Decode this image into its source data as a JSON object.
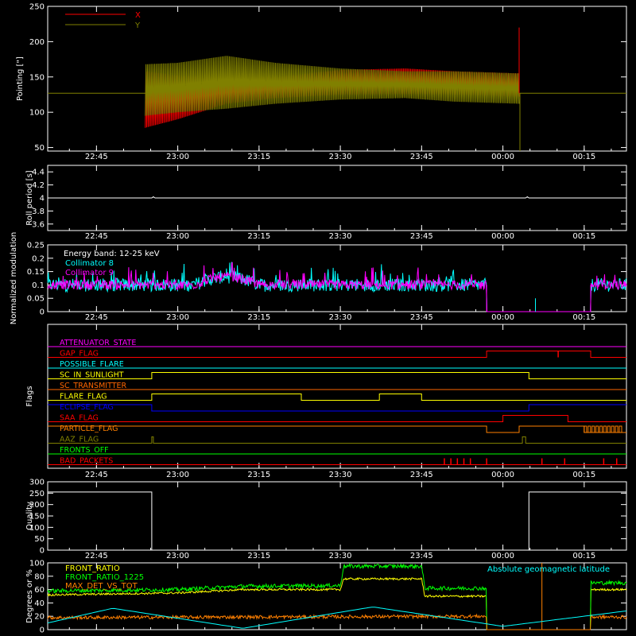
{
  "chart_data": [
    {
      "id": "pointing",
      "type": "line",
      "ylabel": "Pointing [\"]",
      "ylim": [
        45,
        250
      ],
      "yticks": [
        50,
        100,
        150,
        200,
        250
      ],
      "series": [
        {
          "name": "X",
          "color": "#ff0000"
        },
        {
          "name": "Y",
          "color": "#808000"
        }
      ],
      "baseline": 127,
      "active_range": [
        22.9,
        24.05
      ],
      "envelope_x": {
        "t": [
          22.9,
          23.0,
          23.15,
          23.3,
          23.5,
          23.7,
          23.85,
          24.05
        ],
        "lo": [
          78,
          90,
          112,
          120,
          125,
          126,
          125,
          122
        ],
        "hi": [
          158,
          152,
          148,
          150,
          160,
          162,
          158,
          155
        ]
      },
      "envelope_y": {
        "t": [
          22.9,
          23.0,
          23.15,
          23.3,
          23.5,
          23.7,
          23.85,
          24.05
        ],
        "lo": [
          95,
          100,
          105,
          112,
          118,
          120,
          115,
          112
        ],
        "hi": [
          168,
          170,
          180,
          170,
          162,
          158,
          158,
          155
        ]
      },
      "spike": {
        "t": 24.05,
        "value": 220
      }
    },
    {
      "id": "roll",
      "type": "line",
      "ylabel": "Roll period [s]",
      "ylim": [
        3.5,
        4.5
      ],
      "yticks": [
        3.6,
        3.8,
        4.0,
        4.2,
        4.4
      ],
      "series": [
        {
          "color": "#ffffff",
          "value": 4.0
        }
      ]
    },
    {
      "id": "modulation",
      "type": "line",
      "ylabel": "Normalized modulation",
      "ylim": [
        0,
        0.25
      ],
      "yticks": [
        0.0,
        0.05,
        0.1,
        0.15,
        0.2,
        0.25
      ],
      "annotation": "Energy band: 12-25 keV",
      "series": [
        {
          "name": "Collimator 8",
          "color": "#00ffff"
        },
        {
          "name": "Collimator 9",
          "color": "#ff00ff"
        }
      ],
      "gap": [
        23.95,
        24.27
      ],
      "spike": {
        "t": 24.1,
        "value": 0.05
      },
      "base_level": 0.1
    },
    {
      "id": "flags",
      "type": "line",
      "ylabel": "Flags",
      "flags": [
        {
          "name": "ATTENUATOR_STATE",
          "color": "#ff00ff",
          "segments": [
            [
              22.6,
              24.38,
              0
            ]
          ]
        },
        {
          "name": "GAP_FLAG",
          "color": "#ff0000",
          "segments": [
            [
              22.6,
              23.95,
              0
            ],
            [
              23.95,
              24.27,
              1
            ],
            [
              24.27,
              24.38,
              0
            ]
          ],
          "ticks": [
            24.17
          ]
        },
        {
          "name": "POSSIBLE_FLARE",
          "color": "#00ffff",
          "segments": [
            [
              22.6,
              24.38,
              0
            ]
          ]
        },
        {
          "name": "SC_IN_SUNLIGHT",
          "color": "#ffff00",
          "segments": [
            [
              22.6,
              22.92,
              0
            ],
            [
              22.92,
              24.08,
              1
            ],
            [
              24.08,
              24.38,
              0
            ]
          ]
        },
        {
          "name": "SC_TRANSMITTER",
          "color": "#ff6600",
          "segments": [
            [
              22.6,
              24.38,
              0
            ]
          ]
        },
        {
          "name": "FLARE_FLAG",
          "color": "#ffff00",
          "segments": [
            [
              22.6,
              22.92,
              0
            ],
            [
              22.92,
              23.38,
              1
            ],
            [
              23.38,
              23.62,
              0
            ],
            [
              23.62,
              23.75,
              1
            ],
            [
              23.75,
              24.38,
              0
            ]
          ]
        },
        {
          "name": "ECLIPSE_FLAG",
          "color": "#0000ff",
          "segments": [
            [
              22.6,
              22.92,
              1
            ],
            [
              22.92,
              24.08,
              0
            ],
            [
              24.08,
              24.38,
              1
            ]
          ]
        },
        {
          "name": "SAA_FLAG",
          "color": "#ff0000",
          "segments": [
            [
              22.6,
              24.0,
              0
            ],
            [
              24.0,
              24.2,
              1
            ],
            [
              24.2,
              24.38,
              0
            ]
          ]
        },
        {
          "name": "PARTICLE_FLAG",
          "color": "#ff8000",
          "segments": [
            [
              22.6,
              23.95,
              1
            ],
            [
              23.95,
              24.05,
              0
            ],
            [
              24.05,
              24.25,
              1
            ],
            [
              24.25,
              24.38,
              0
            ]
          ]
        },
        {
          "name": "AAZ_FLAG",
          "color": "#808000",
          "segments": [
            [
              22.6,
              22.92,
              0
            ],
            [
              22.92,
              22.925,
              1
            ],
            [
              22.925,
              24.06,
              0
            ],
            [
              24.06,
              24.07,
              1
            ],
            [
              24.07,
              24.38,
              0
            ]
          ]
        },
        {
          "name": "FRONTS_OFF",
          "color": "#00ff00",
          "segments": [
            [
              22.6,
              24.38,
              0
            ]
          ]
        },
        {
          "name": "BAD_PACKETS",
          "color": "#ff0000",
          "segments": [
            [
              22.6,
              24.38,
              0
            ]
          ],
          "ticks": [
            23.82,
            23.84,
            23.86,
            23.88,
            23.9,
            23.95,
            24.12,
            24.19,
            24.31,
            24.35
          ]
        }
      ]
    },
    {
      "id": "quality",
      "type": "line",
      "ylabel": "Quality",
      "ylim": [
        0,
        300
      ],
      "yticks": [
        0,
        50,
        100,
        150,
        200,
        250,
        300
      ],
      "series": [
        {
          "color": "#ffffff",
          "segments": [
            [
              22.6,
              22.92,
              255
            ],
            [
              22.92,
              24.08,
              0
            ],
            [
              24.08,
              24.38,
              255
            ]
          ]
        }
      ]
    },
    {
      "id": "ratios",
      "type": "line",
      "ylabel": "Degrees or %",
      "ylim": [
        0,
        100
      ],
      "yticks": [
        0,
        20,
        40,
        60,
        80,
        100
      ],
      "annotation": "Absolute geomagnetic latitude",
      "annotation_color": "#00ffff",
      "series": [
        {
          "name": "FRONT_RATIO",
          "color": "#ffff00",
          "t": [
            22.6,
            23.0,
            23.2,
            23.5,
            23.51,
            23.75,
            23.76,
            23.95
          ],
          "v": [
            52,
            55,
            60,
            60,
            76,
            76,
            50,
            50
          ]
        },
        {
          "name": "FRONT_RATIO_1225",
          "color": "#00ff00",
          "t": [
            22.6,
            23.0,
            23.2,
            23.5,
            23.51,
            23.75,
            23.76,
            23.95
          ],
          "v": [
            58,
            60,
            65,
            66,
            95,
            95,
            62,
            62
          ]
        },
        {
          "name": "MAX_DET_VS_TOT",
          "color": "#ff8000",
          "t": [
            22.6,
            23.95
          ],
          "v": [
            18,
            20
          ]
        }
      ],
      "latitude": {
        "t": [
          22.6,
          22.8,
          23.2,
          23.6,
          24.0,
          24.38
        ],
        "v": [
          10,
          32,
          2,
          34,
          5,
          28
        ]
      }
    }
  ],
  "x_axis": {
    "range_hours": [
      22.6,
      24.38
    ],
    "tick_hours": [
      22.75,
      23.0,
      23.25,
      23.5,
      23.75,
      24.0,
      24.25
    ],
    "tick_labels": [
      "22:45",
      "23:00",
      "23:15",
      "23:30",
      "23:45",
      "00:00",
      "00:15"
    ]
  }
}
